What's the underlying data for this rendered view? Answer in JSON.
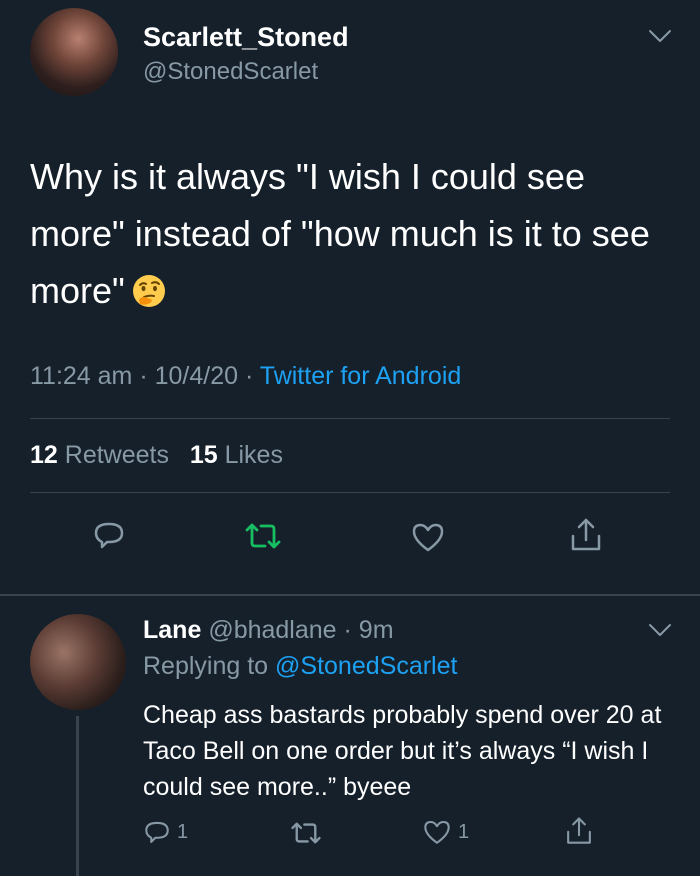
{
  "tweet": {
    "display_name": "Scarlett_Stoned",
    "handle": "@StonedScarlet",
    "text": "Why is it always \"I wish I could see more\" instead of \"how much is it to see more\"",
    "emoji": "thinking-face",
    "time": "11:24 am",
    "date": "10/4/20",
    "source": "Twitter for Android",
    "retweets_count": "12",
    "retweets_label": "Retweets",
    "likes_count": "15",
    "likes_label": "Likes"
  },
  "reply": {
    "name": "Lane",
    "handle": "@bhadlane",
    "time_ago": "9m",
    "replying_to_label": "Replying to",
    "replying_to_handle": "@StonedScarlet",
    "text": "Cheap ass bastards probably spend over 20 at Taco Bell on one order but it’s always “I wish I could see more..” byeee",
    "reply_count": "1",
    "like_count": "1"
  },
  "icons": {
    "reply": "reply-icon",
    "retweet": "retweet-icon",
    "like": "heart-icon",
    "share": "share-icon",
    "menu": "chevron-down-icon"
  },
  "colors": {
    "background": "#15202b",
    "link": "#1da1f2",
    "retweet_active": "#17bf63",
    "muted": "#8899a6"
  }
}
